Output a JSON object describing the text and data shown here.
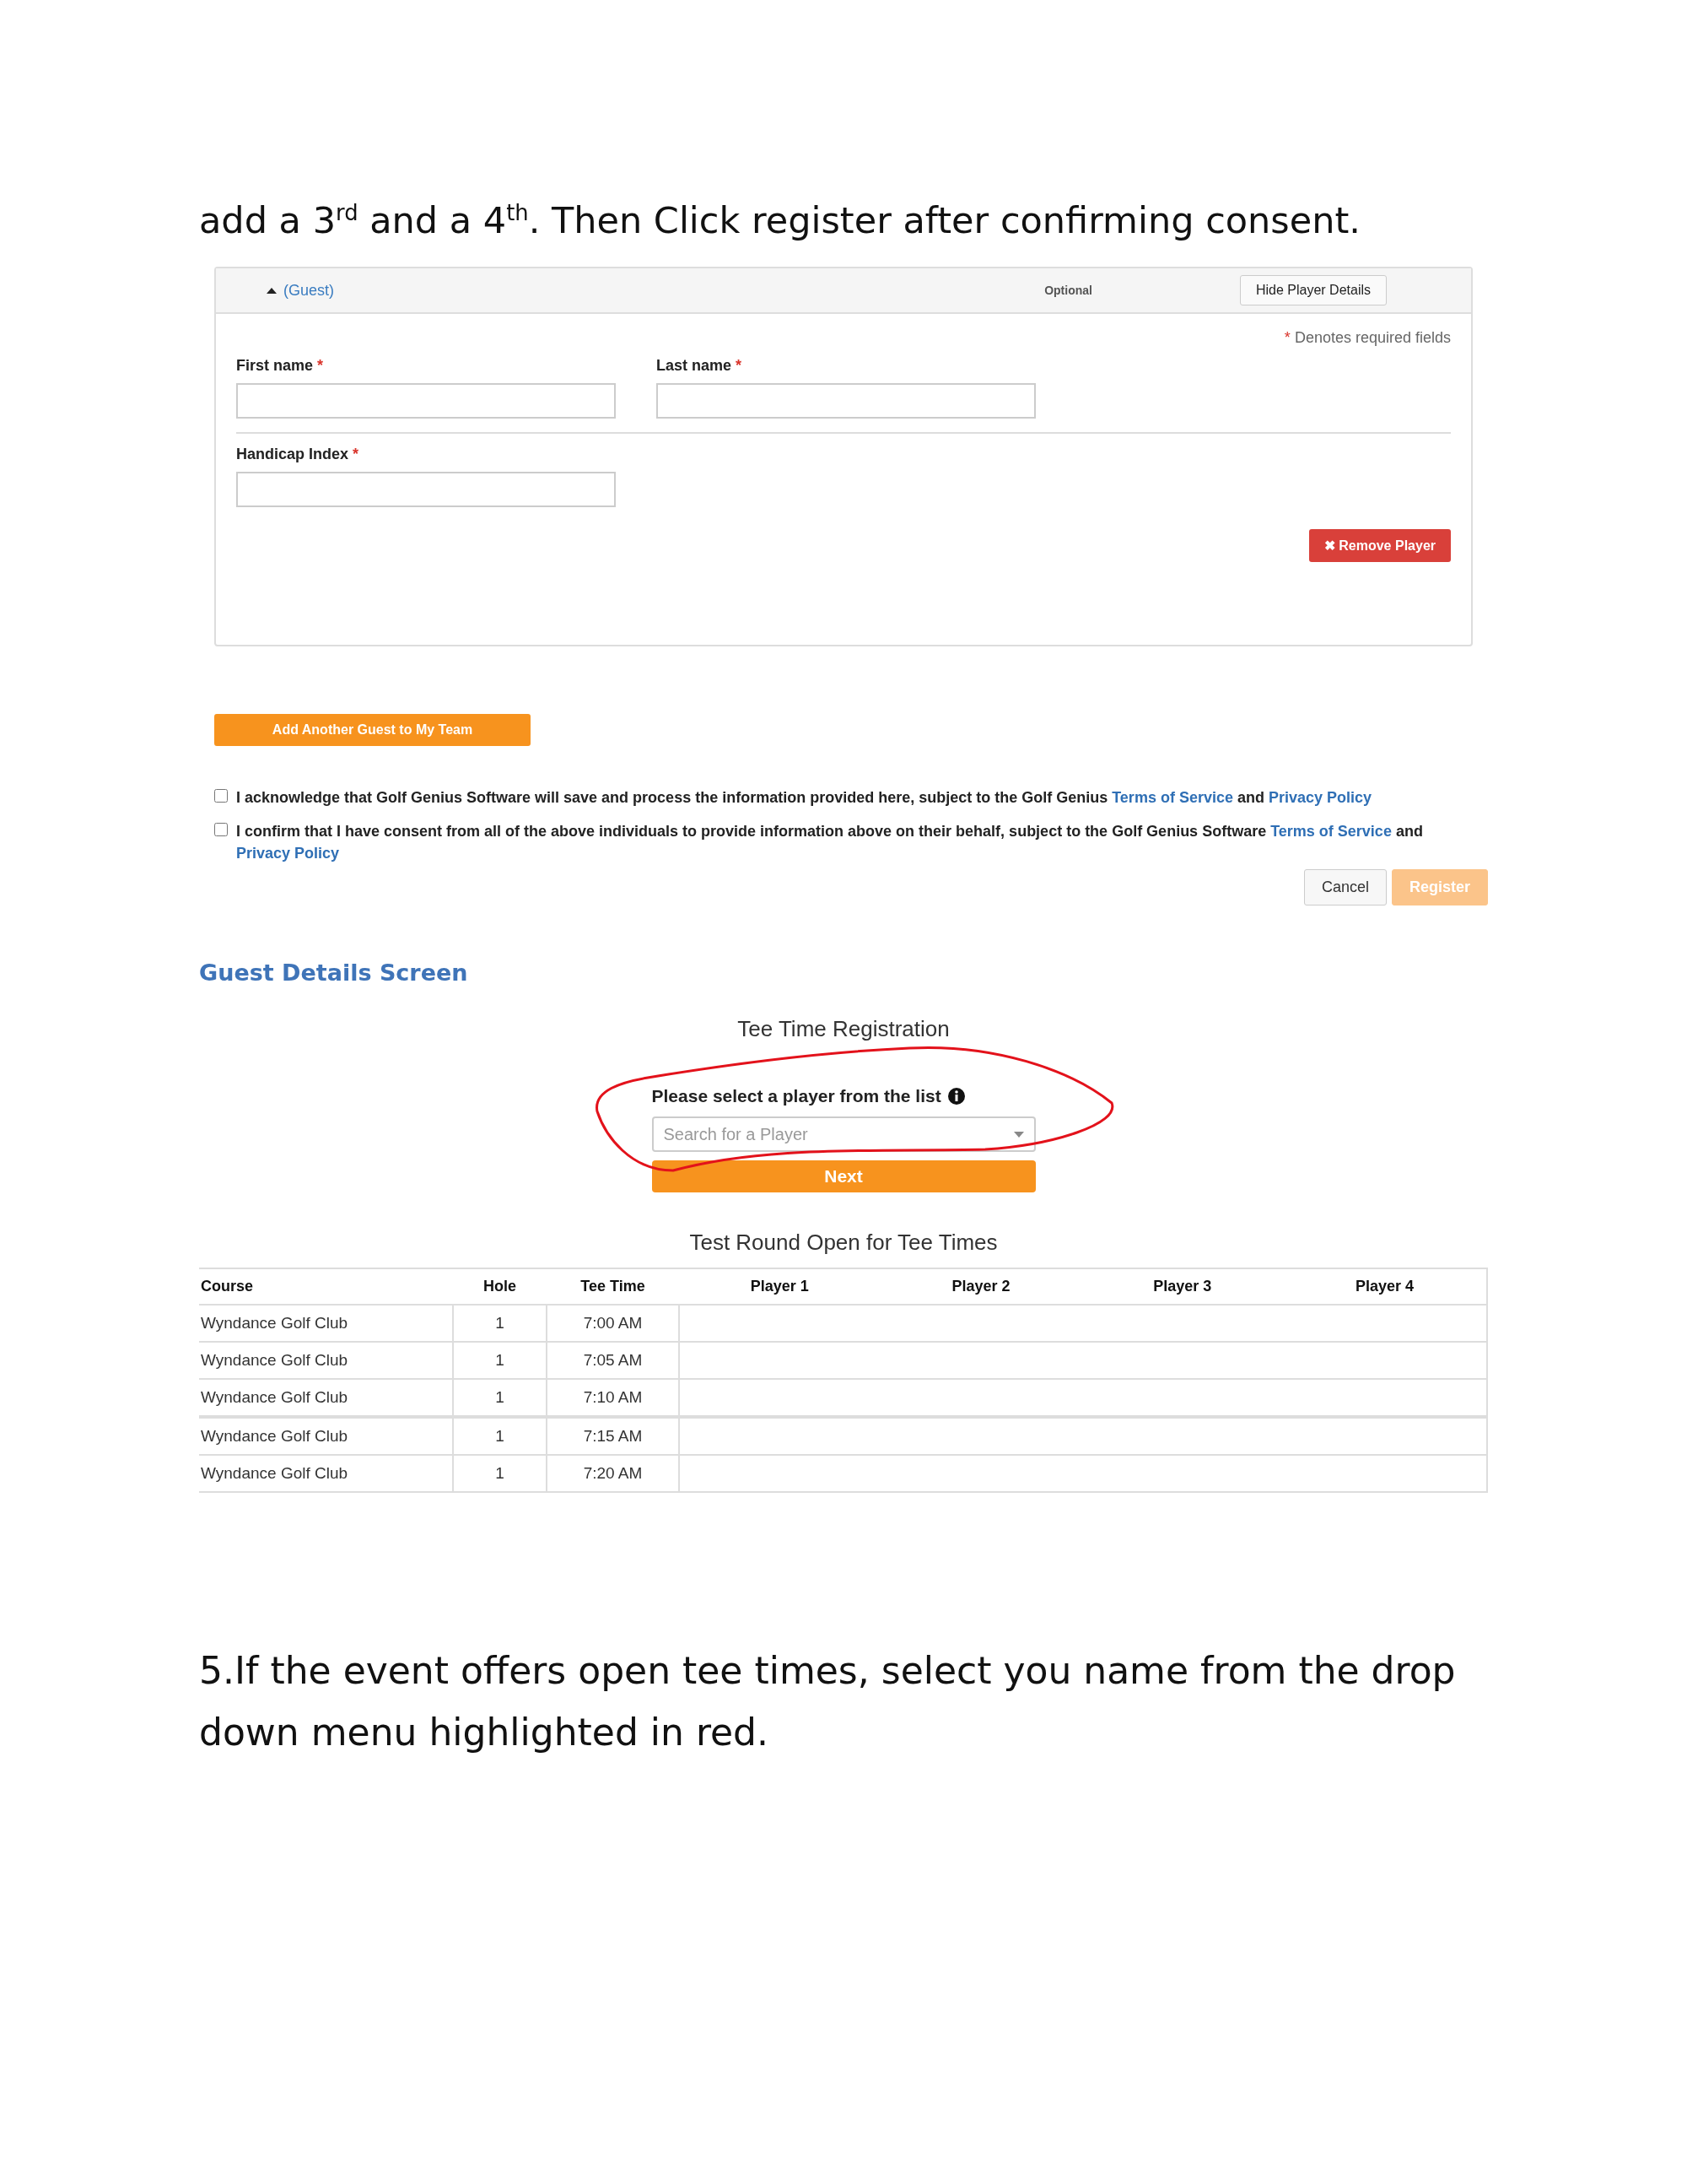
{
  "instruction": "add a 3$^{rd}$ and a 4$^{th}$.  Then Click register after confirming consent.",
  "guest_panel": {
    "toggle": "(Guest)",
    "expanded": true,
    "optional": "Optional",
    "hide_button": "Hide Player Details",
    "required_mark": "*",
    "required_note": "Denotes required fields",
    "fields": [
      {
        "label": "First name",
        "required": true
      },
      {
        "label": "Last name",
        "required": true
      },
      {
        "label": "Handicap Index",
        "required": true
      }
    ],
    "remove_icon": "✖",
    "remove_button": "Remove Player"
  },
  "add_guest_button": "Add Another Guest to My Team",
  "consents": [
    {
      "checked": false,
      "parts": [
        {
          "text": "I acknowledge that Golf Genius Software will save and process the information provided here, subject to the Golf Genius ",
          "link": false
        },
        {
          "text": "Terms of Service",
          "link": true
        },
        {
          "text": " and ",
          "link": false
        },
        {
          "text": "Privacy Policy",
          "link": true
        }
      ]
    },
    {
      "checked": false,
      "parts": [
        {
          "text": "I confirm that I have consent from all of the above individuals to provide information above on their behalf, subject to the Golf Genius Software ",
          "link": false
        },
        {
          "text": "Terms of Service",
          "link": true
        },
        {
          "text": " and ",
          "link": false
        },
        {
          "text": "Privacy Policy",
          "link": true
        }
      ]
    }
  ],
  "actions": [
    {
      "label": "Cancel",
      "kind": "secondary",
      "disabled": false
    },
    {
      "label": "Register",
      "kind": "primary",
      "disabled": true
    }
  ],
  "section_heading": "Guest Details Screen",
  "registration": {
    "title": "Tee Time Registration",
    "label": "Please select a player from the list",
    "select_placeholder": "Search for a Player",
    "next_button": "Next"
  },
  "table": {
    "title": "Test Round Open for Tee Times",
    "columns": [
      "Course",
      "Hole",
      "Tee Time",
      "Player 1",
      "Player 2",
      "Player 3",
      "Player 4"
    ],
    "rows": [
      [
        "Wyndance Golf Club",
        "1",
        "7:00 AM"
      ],
      [
        "Wyndance Golf Club",
        "1",
        "7:05 AM"
      ],
      [
        "Wyndance Golf Club",
        "1",
        "7:10 AM"
      ],
      [
        "Wyndance Golf Club",
        "1",
        "7:15 AM"
      ],
      [
        "Wyndance Golf Club",
        "1",
        "7:20 AM"
      ]
    ]
  },
  "footer_text": "5.If the event offers open tee times, select you name from the drop down menu highlighted in red."
}
